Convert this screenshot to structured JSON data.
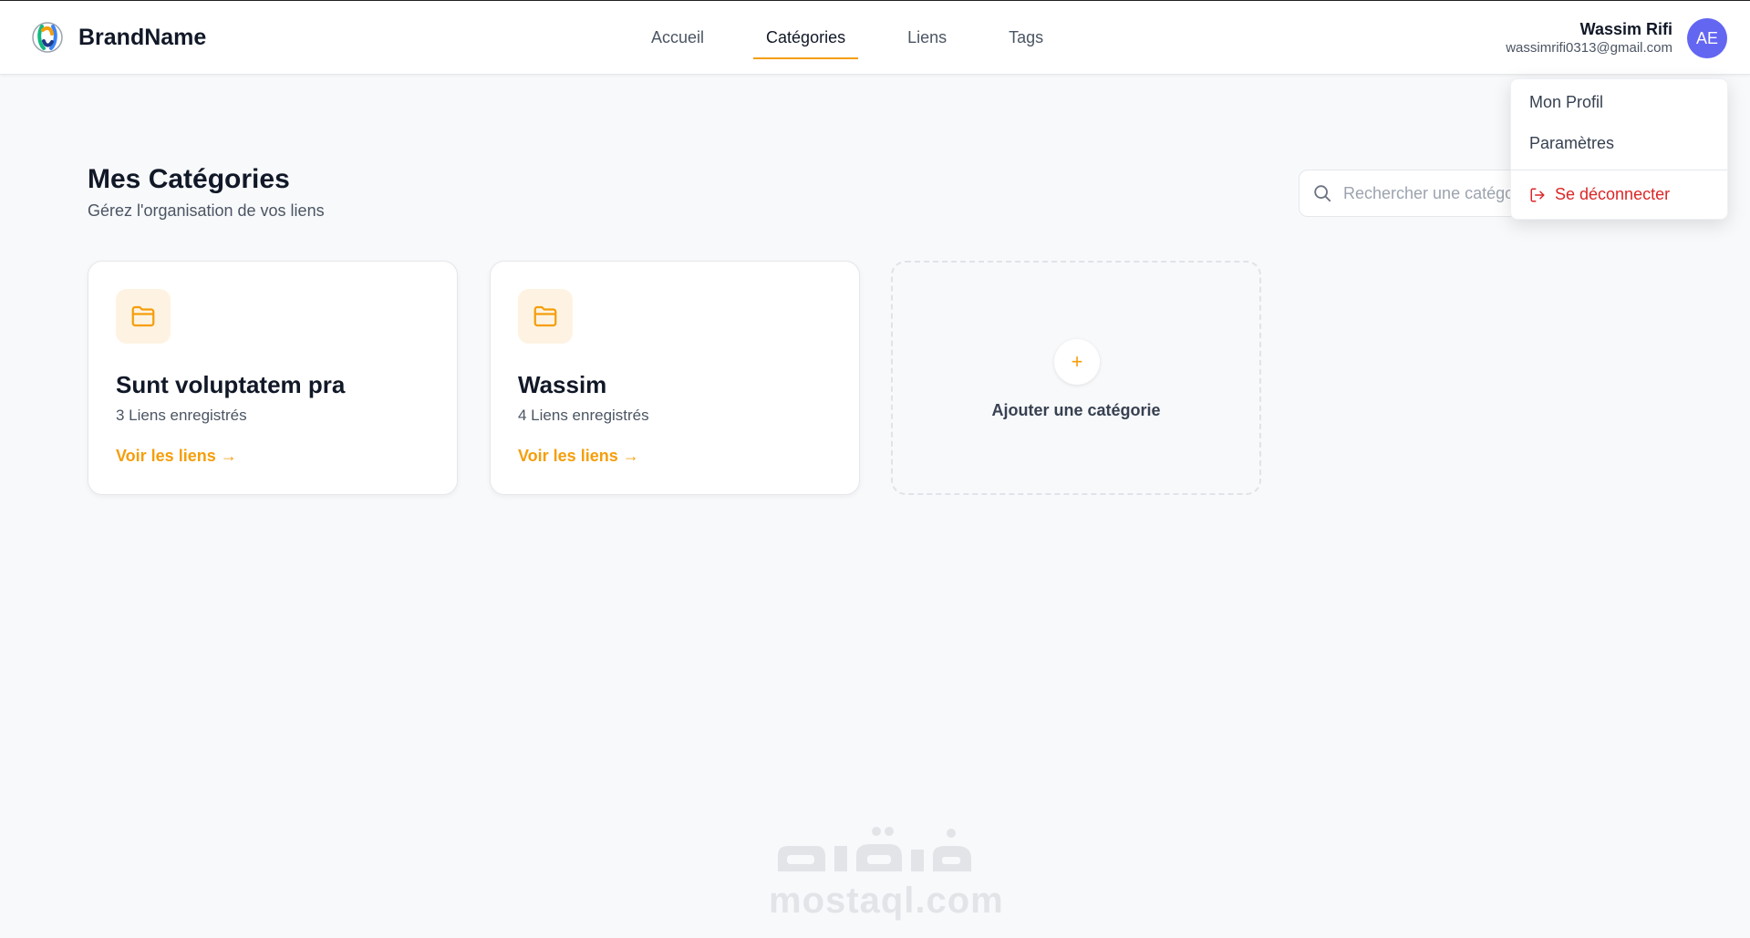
{
  "brand": {
    "name": "BrandName"
  },
  "nav": {
    "items": [
      "Accueil",
      "Catégories",
      "Liens",
      "Tags"
    ],
    "active": "Catégories"
  },
  "user": {
    "name": "Wassim Rifi",
    "email": "wassimrifi0313@gmail.com",
    "initials": "AE"
  },
  "dropdown": {
    "items": [
      "Mon Profil",
      "Paramètres"
    ],
    "logout_label": "Se déconnecter"
  },
  "page": {
    "title": "Mes Catégories",
    "subtitle": "Gérez l'organisation de vos liens"
  },
  "search": {
    "placeholder": "Rechercher une catégorie..."
  },
  "categories": [
    {
      "name": "Sunt voluptatem pra",
      "count": "3 Liens enregistrés",
      "link": "Voir les liens →"
    },
    {
      "name": "Wassim",
      "count": "4 Liens enregistrés",
      "link": "Voir les liens →"
    }
  ],
  "add_category": {
    "icon": "+",
    "label": "Ajouter une catégorie"
  },
  "watermark": {
    "text": "mostaql.com"
  },
  "colors": {
    "accent": "#f59e0b",
    "avatar": "#6366f1",
    "danger": "#dc2626"
  }
}
